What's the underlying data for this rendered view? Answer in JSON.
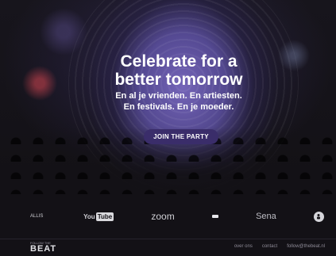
{
  "hero": {
    "headline_line1": "Celebrate for a",
    "headline_line2": "better tomorrow",
    "sub_line1": "En al je vrienden. En artiesten.",
    "sub_line2": "En festivals. En je moeder.",
    "cta_label": "JOIN THE PARTY"
  },
  "partners": {
    "label": "",
    "logos": [
      {
        "name": "allis-logo",
        "text": "ALLIS"
      },
      {
        "name": "youtube-logo",
        "text_you": "You",
        "text_tube": "Tube"
      },
      {
        "name": "zoom-logo",
        "text": "zoom"
      },
      {
        "name": "ticket-logo",
        "text": ""
      },
      {
        "name": "sena-logo",
        "text": "Sena"
      },
      {
        "name": "circle-logo",
        "text": ""
      }
    ]
  },
  "footer": {
    "logo_small": "FOLLOW THE",
    "logo_big": "BEAT",
    "links": [
      "over ons",
      "contact",
      "follow@thebeat.nl"
    ]
  },
  "colors": {
    "background": "#131116",
    "button": "#3a2d6a",
    "stage_glow": "#7868be"
  }
}
